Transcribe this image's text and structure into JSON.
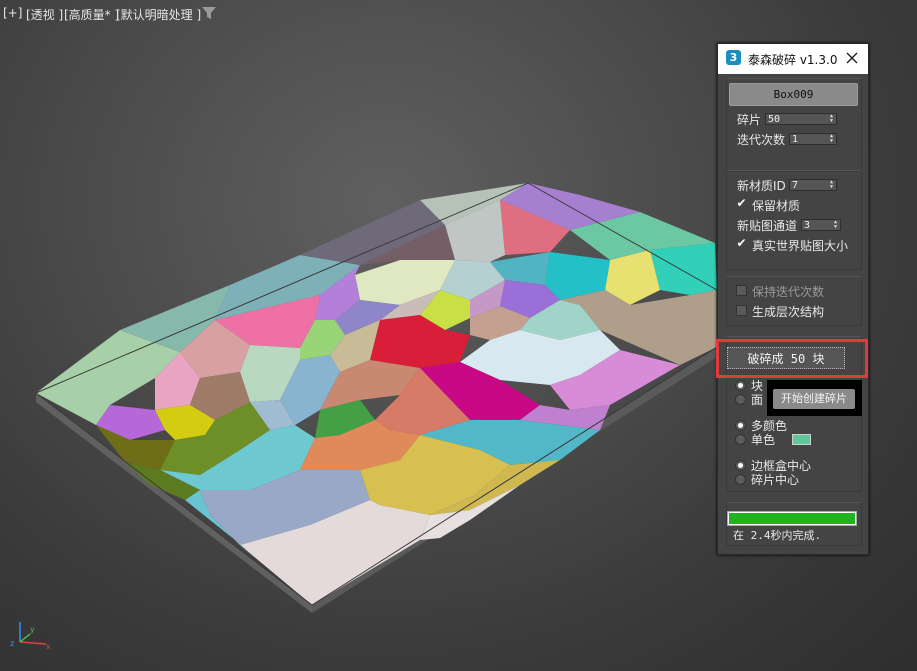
{
  "viewport_labels": {
    "plus": "[+]",
    "view": "[透视 ]",
    "quality": "[高质量* ]",
    "lighting": "[默认明暗处理 ]"
  },
  "panel": {
    "app_icon_glyph": "3",
    "title": "泰森破碎 v1.3.0",
    "object_button": "Box009",
    "fragments_label": "碎片",
    "fragments_value": "50",
    "iterations_label": "迭代次数",
    "iterations_value": "1",
    "material_id_label": "新材质ID",
    "material_id_value": "7",
    "keep_material_label": "保留材质",
    "keep_material_checked": true,
    "map_channel_label": "新贴图通道",
    "map_channel_value": "3",
    "real_world_label": "真实世界贴图大小",
    "real_world_checked": true,
    "keep_iterations_label": "保持迭代次数",
    "keep_iterations_checked": false,
    "hierarchy_label": "生成层次结构",
    "hierarchy_checked": false,
    "break_button": "破碎成 50 块",
    "tooltip": "开始创建碎片",
    "mode_block_label": "块",
    "mode_face_label": "面",
    "multi_color_label": "多颜色",
    "single_color_label": "单色",
    "single_color_swatch": "#5ec89a",
    "pivot_bbox_label": "边框盒中心",
    "pivot_fragment_label": "碎片中心",
    "progress": 1.0,
    "status": "在 2.4秒内完成."
  },
  "colors": {
    "highlight": "#e23a3a",
    "progress_fill": "#1fb31f"
  }
}
